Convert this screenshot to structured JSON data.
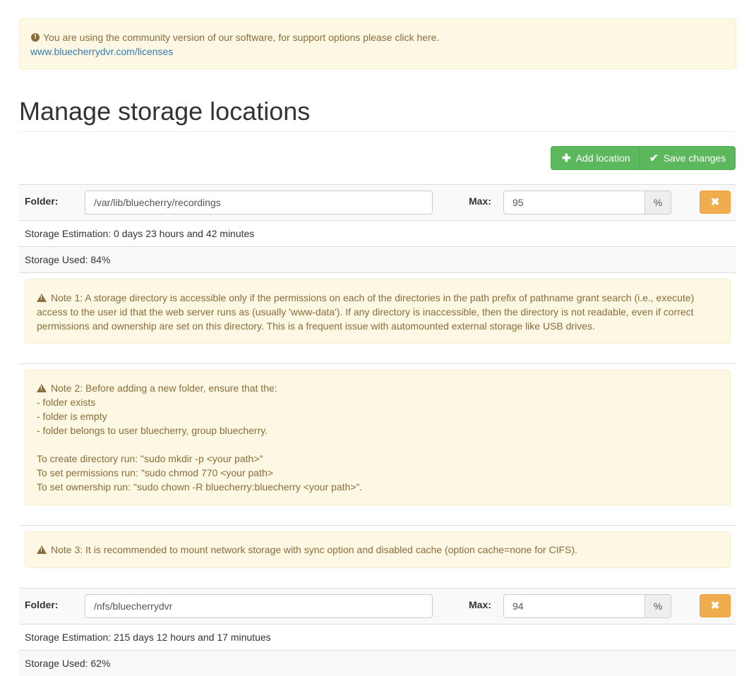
{
  "notice": {
    "icon": "exclamation-circle-icon",
    "text": "You are using the community version of our software, for support options please click here.",
    "link": "www.bluecherrydvr.com/licenses"
  },
  "page_title": "Manage storage locations",
  "toolbar": {
    "add_label": "Add location",
    "save_label": "Save changes"
  },
  "locations": [
    {
      "folder_label": "Folder:",
      "folder_value": "/var/lib/bluecherry/recordings",
      "max_label": "Max:",
      "max_value": "95",
      "unit": "%",
      "estimation": "Storage Estimation: 0 days 23 hours and 42 minutes",
      "used": "Storage Used: 84%"
    },
    {
      "folder_label": "Folder:",
      "folder_value": "/nfs/bluecherrydvr",
      "max_label": "Max:",
      "max_value": "94",
      "unit": "%",
      "estimation": "Storage Estimation: 215 days 12 hours and 17 minutues",
      "used": "Storage Used: 62%"
    }
  ],
  "notes": {
    "note1": "Note 1: A storage directory is accessible only if the permissions on each of the directories in the path prefix of pathname grant search (i.e., execute) access to the user id that the web server runs as (usually 'www-data'). If any directory is inaccessible, then the directory is not readable, even if correct permissions and ownership are set on this directory. This is a frequent issue with automounted external storage like USB drives.",
    "note2_lines": [
      "Note 2: Before adding a new folder, ensure that the:",
      "- folder exists",
      "- folder is empty",
      "- folder belongs to user bluecherry, group bluecherry.",
      "",
      "To create directory run: \"sudo mkdir -p <your path>\"",
      "To set permissions run: \"sudo chmod 770 <your path>",
      "To set ownership run: \"sudo chown -R bluecherry:bluecherry <your path>\"."
    ],
    "note3": "Note 3: It is recommended to mount network storage with sync option and disabled cache (option cache=none for CIFS)."
  },
  "colors": {
    "success": "#5cb85c",
    "warning_button": "#f0ad4e",
    "alert_bg": "#fcf8e3",
    "alert_text": "#8a6d3b",
    "link": "#337ab7"
  }
}
